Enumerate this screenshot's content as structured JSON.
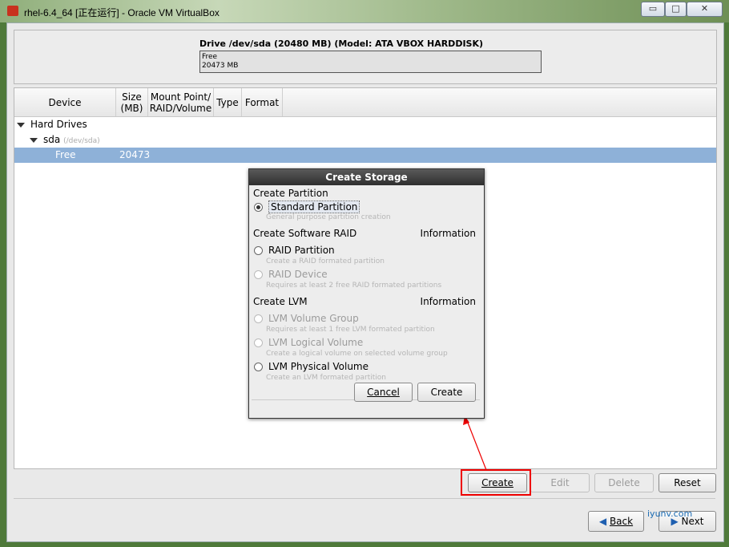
{
  "window": {
    "title": "rhel-6.4_64 [正在运行] - Oracle VM VirtualBox",
    "controls": {
      "minimize": "▭",
      "maximize": "□",
      "close": "✕"
    }
  },
  "drive": {
    "title": "Drive /dev/sda (20480 MB) (Model: ATA VBOX HARDDISK)",
    "bar_label": "Free",
    "bar_size": "20473 MB"
  },
  "table": {
    "headers": {
      "device": "Device",
      "size": "Size\n(MB)",
      "mount": "Mount Point/\nRAID/Volume",
      "type": "Type",
      "format": "Format"
    },
    "rows": [
      {
        "name": "Hard Drives"
      },
      {
        "name": "sda",
        "path": "(/dev/sda)"
      },
      {
        "name": "Free",
        "size": "20473"
      }
    ]
  },
  "buttons": {
    "create": "Create",
    "edit": "Edit",
    "delete": "Delete",
    "reset": "Reset",
    "back": "Back",
    "next": "Next"
  },
  "dialog": {
    "title": "Create Storage",
    "partition_header": "Create Partition",
    "standard_partition": "Standard Partition",
    "standard_desc": "General purpose partition creation",
    "raid_header": "Create Software RAID",
    "information": "Information",
    "raid_partition": "RAID Partition",
    "raid_partition_desc": "Create a RAID formated partition",
    "raid_device": "RAID Device",
    "raid_device_desc": "Requires at least 2 free RAID formated partitions",
    "lvm_header": "Create LVM",
    "lvm_vg": "LVM Volume Group",
    "lvm_vg_desc": "Requires at least 1 free LVM formated partition",
    "lvm_lv": "LVM Logical Volume",
    "lvm_lv_desc": "Create a logical volume on selected volume group",
    "lvm_pv": "LVM Physical Volume",
    "lvm_pv_desc": "Create an LVM formated partition",
    "cancel": "Cancel",
    "create": "Create"
  },
  "watermark": "iyunv.com"
}
